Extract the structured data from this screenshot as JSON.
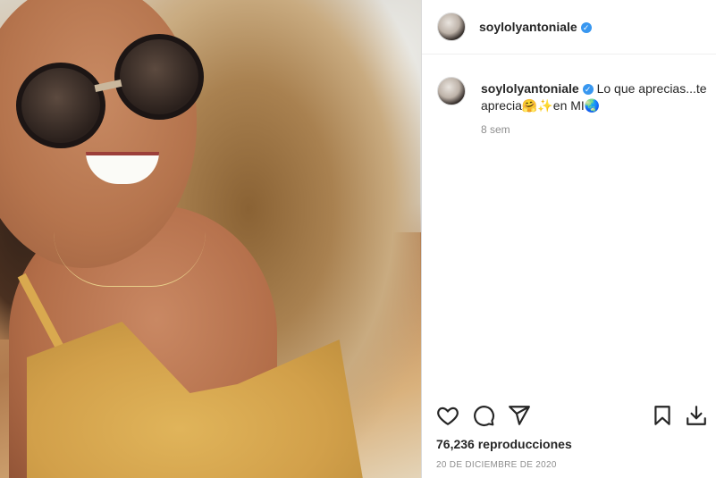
{
  "post": {
    "username": "soylolyantoniale",
    "verified_glyph": "✓",
    "caption_text": "Lo que aprecias...te aprecia🤗✨en MI🌏",
    "time_ago": "8 sem",
    "views": "76,236 reproducciones",
    "date": "20 DE DICIEMBRE DE 2020"
  },
  "icons": {
    "like": "heart-icon",
    "comment": "comment-icon",
    "share": "share-icon",
    "save": "bookmark-icon",
    "download": "download-icon"
  },
  "colors": {
    "text_primary": "#262626",
    "text_secondary": "#8e8e8e",
    "verified_blue": "#3897f0",
    "border": "#dbdbdb"
  }
}
